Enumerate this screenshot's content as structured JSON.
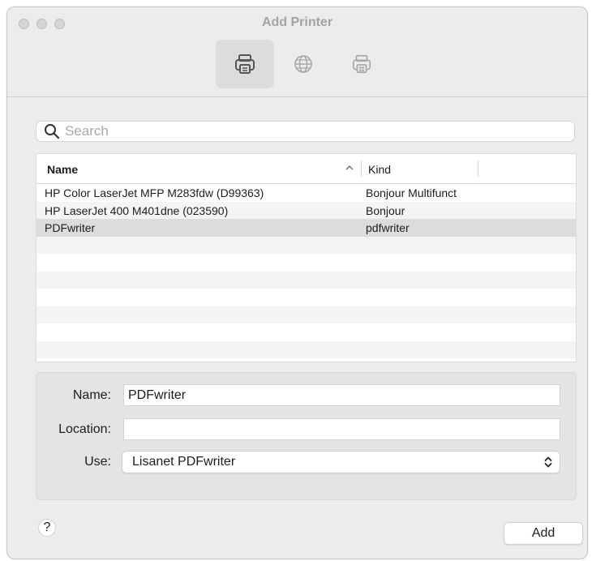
{
  "window": {
    "title": "Add Printer"
  },
  "toolbar": {
    "items": [
      {
        "icon": "default-printer-icon",
        "active": true
      },
      {
        "icon": "ip-globe-icon",
        "active": false
      },
      {
        "icon": "windows-printer-icon",
        "active": false
      }
    ]
  },
  "search": {
    "placeholder": "Search",
    "value": ""
  },
  "table": {
    "columns": [
      "Name",
      "Kind"
    ],
    "sort_indicator": "^",
    "rows": [
      {
        "name": "HP Color LaserJet MFP M283fdw (D99363)",
        "kind": "Bonjour Multifunct",
        "selected": false
      },
      {
        "name": "HP LaserJet 400 M401dne (023590)",
        "kind": "Bonjour",
        "selected": false
      },
      {
        "name": "PDFwriter",
        "kind": "pdfwriter",
        "selected": true
      }
    ]
  },
  "form": {
    "name_label": "Name:",
    "name_value": "PDFwriter",
    "location_label": "Location:",
    "location_value": "",
    "use_label": "Use:",
    "use_value": "Lisanet PDFwriter"
  },
  "buttons": {
    "help": "?",
    "add": "Add"
  },
  "colors": {
    "window_bg": "#ececec",
    "selected_row": "#dcdcdc",
    "alt_row": "#f4f4f4"
  }
}
